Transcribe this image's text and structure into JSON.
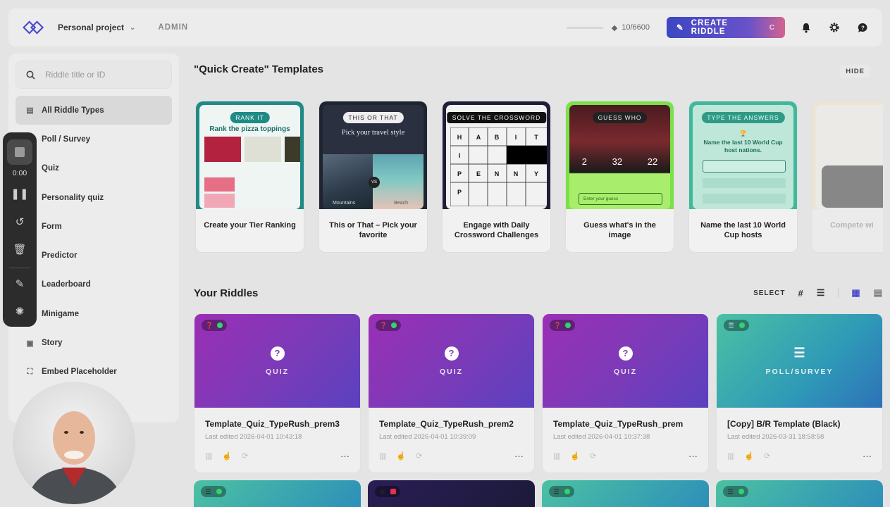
{
  "topbar": {
    "project": "Personal project",
    "admin": "ADMIN",
    "credits": "10/6600",
    "create_label": "CREATE RIDDLE",
    "create_shortcut": "C"
  },
  "sidebar": {
    "search_placeholder": "Riddle title or ID",
    "items": [
      {
        "label": "All Riddle Types"
      },
      {
        "label": "Poll / Survey"
      },
      {
        "label": "Quiz"
      },
      {
        "label": "Personality quiz"
      },
      {
        "label": "Form"
      },
      {
        "label": "Predictor"
      },
      {
        "label": "Leaderboard"
      },
      {
        "label": "Minigame"
      },
      {
        "label": "Story"
      },
      {
        "label": "Embed Placeholder"
      }
    ]
  },
  "recorder": {
    "time": "0:00"
  },
  "templates": {
    "title": "\"Quick Create\" Templates",
    "hide": "HIDE",
    "items": [
      {
        "tag": "RANK IT",
        "headline": "Rank the pizza toppings",
        "caption": "Create your Tier Ranking"
      },
      {
        "tag": "THIS OR THAT",
        "headline": "Pick your travel style",
        "left": "Mountains",
        "right": "Beach",
        "caption": "This or That – Pick your favorite"
      },
      {
        "tag": "SOLVE THE CROSSWORD",
        "caption": "Engage with Daily Crossword Challenges"
      },
      {
        "tag": "GUESS WHO",
        "caption": "Guess what's in the image",
        "input_placeholder": "Enter your guess"
      },
      {
        "tag": "TYPE THE ANSWERS",
        "headline": "Name the last 10 World Cup host nations.",
        "caption": "Name the last 10 World Cup hosts"
      },
      {
        "caption": "Compete wi"
      }
    ]
  },
  "riddles": {
    "title": "Your Riddles",
    "select": "SELECT",
    "cards": [
      {
        "type": "QUIZ",
        "title": "Template_Quiz_TypeRush_prem3",
        "date": "Last edited 2026-04-01 10:43:18"
      },
      {
        "type": "QUIZ",
        "title": "Template_Quiz_TypeRush_prem2",
        "date": "Last edited 2026-04-01 10:39:09"
      },
      {
        "type": "QUIZ",
        "title": "Template_Quiz_TypeRush_prem",
        "date": "Last edited 2026-04-01 10:37:38"
      },
      {
        "type": "POLL/SURVEY",
        "title": "[Copy] B/R Template (Black)",
        "date": "Last edited 2026-03-31 18:58:58"
      }
    ]
  },
  "colors": {
    "accent": "#4a4ccf",
    "quiz_gradient_start": "#9b2fb5",
    "poll_gradient_start": "#4cc1a3",
    "status_dot": "#2fd46b"
  }
}
